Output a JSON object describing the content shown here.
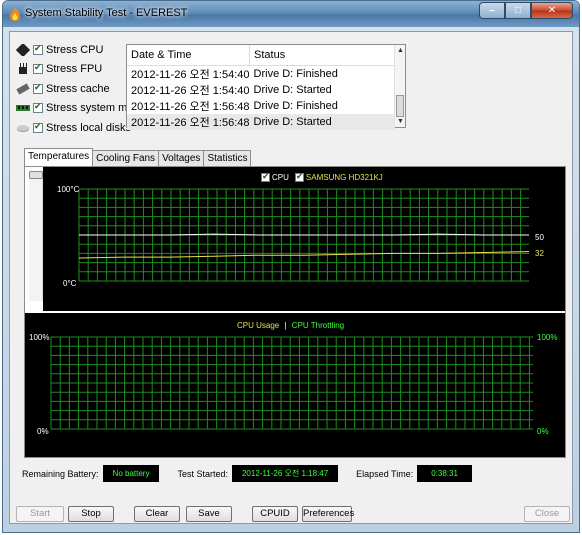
{
  "window": {
    "title": "System Stability Test - EVEREST",
    "controls": {
      "minimize": "–",
      "maximize": "□",
      "close": "✕"
    }
  },
  "stress": [
    {
      "label": "Stress CPU",
      "icon": "cpu-icon",
      "checked": true
    },
    {
      "label": "Stress FPU",
      "icon": "fpu-icon",
      "checked": true
    },
    {
      "label": "Stress cache",
      "icon": "cache-icon",
      "checked": true
    },
    {
      "label": "Stress system memory",
      "icon": "memory-icon",
      "checked": true
    },
    {
      "label": "Stress local disks",
      "icon": "disk-icon",
      "checked": true
    }
  ],
  "log": {
    "columns": [
      "Date & Time",
      "Status"
    ],
    "rows": [
      [
        "2012-11-26 오전 1:54:40",
        "Drive D: Finished"
      ],
      [
        "2012-11-26 오전 1:54:40",
        "Drive D: Started"
      ],
      [
        "2012-11-26 오전 1:56:48",
        "Drive D: Finished"
      ],
      [
        "2012-11-26 오전 1:56:48",
        "Drive D: Started"
      ]
    ]
  },
  "tabs": [
    "Temperatures",
    "Cooling Fans",
    "Voltages",
    "Statistics"
  ],
  "temp_graph": {
    "legend": [
      "CPU",
      "SAMSUNG HD321KJ"
    ],
    "y_top": "100°C",
    "y_bottom": "0°C",
    "cpu_value": "50",
    "disk_value": "32",
    "colors": {
      "cpu": "#ffffff",
      "disk": "#e6e24a",
      "grid": "#1d8f1d"
    }
  },
  "usage_graph": {
    "legend_left": "CPU Usage",
    "separator": "|",
    "legend_right": "CPU Throttling",
    "y_top_left": "100%",
    "y_bottom_left": "0%",
    "y_top_right": "100%",
    "y_bottom_right": "0%",
    "colors": {
      "usage": "#e6e24a",
      "throttle": "#3fff3f",
      "grid": "#1d8f1d"
    }
  },
  "status": {
    "battery_label": "Remaining Battery:",
    "battery_value": "No battery",
    "started_label": "Test Started:",
    "started_value": "2012-11-26 오전 1:18:47",
    "elapsed_label": "Elapsed Time:",
    "elapsed_value": "0:38:31"
  },
  "buttons": {
    "start": "Start",
    "stop": "Stop",
    "clear": "Clear",
    "save": "Save",
    "cpuid": "CPUID",
    "preferences": "Preferences",
    "close": "Close"
  },
  "chart_data": [
    {
      "type": "line",
      "title": "",
      "ylim": [
        0,
        100
      ],
      "series": [
        {
          "name": "CPU",
          "values": [
            50,
            50,
            50,
            51,
            50,
            50,
            50,
            50,
            51,
            50,
            50
          ]
        },
        {
          "name": "SAMSUNG HD321KJ",
          "values": [
            25,
            26,
            26,
            27,
            28,
            28,
            29,
            30,
            30,
            31,
            32
          ]
        }
      ]
    },
    {
      "type": "line",
      "title": "",
      "ylim": [
        0,
        100
      ],
      "series": [
        {
          "name": "CPU Usage",
          "values": []
        },
        {
          "name": "CPU Throttling",
          "values": []
        }
      ]
    }
  ]
}
